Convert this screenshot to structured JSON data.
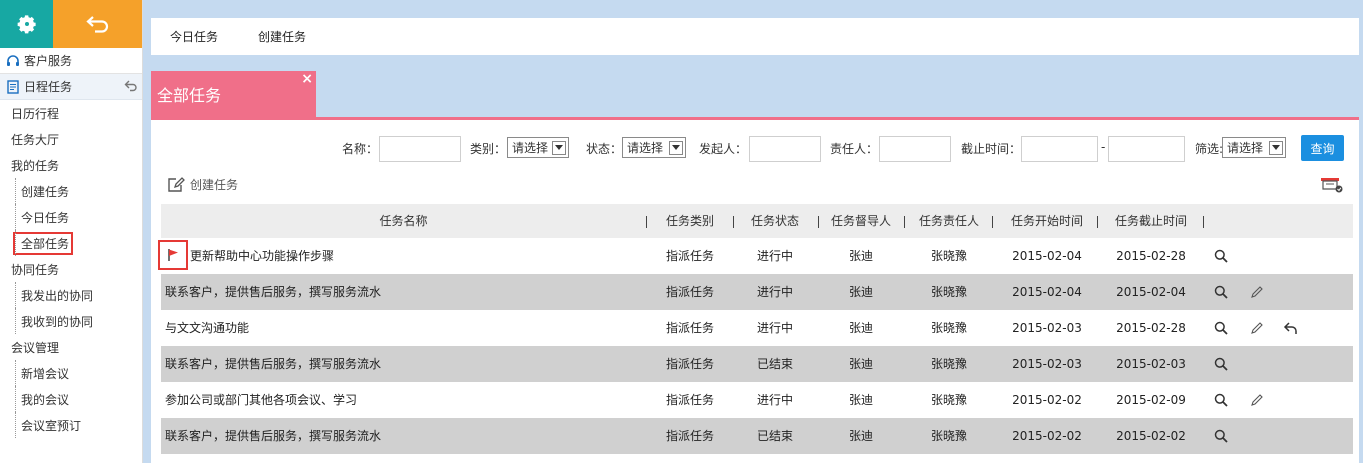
{
  "sidebar": {
    "customer_service": "客户服务",
    "schedule_section": "日程任务",
    "items": [
      {
        "label": "日历行程",
        "kind": "item"
      },
      {
        "label": "任务大厅",
        "kind": "item"
      },
      {
        "label": "我的任务",
        "kind": "item"
      },
      {
        "label": "创建任务",
        "kind": "sub"
      },
      {
        "label": "今日任务",
        "kind": "sub"
      },
      {
        "label": "全部任务",
        "kind": "sub",
        "active": true
      },
      {
        "label": "协同任务",
        "kind": "item"
      },
      {
        "label": "我发出的协同",
        "kind": "sub"
      },
      {
        "label": "我收到的协同",
        "kind": "sub"
      },
      {
        "label": "会议管理",
        "kind": "item"
      },
      {
        "label": "新增会议",
        "kind": "sub"
      },
      {
        "label": "我的会议",
        "kind": "sub"
      },
      {
        "label": "会议室预订",
        "kind": "sub"
      }
    ]
  },
  "topbar": {
    "tabs": [
      "今日任务",
      "创建任务"
    ]
  },
  "panel": {
    "title": "全部任务",
    "close": "×"
  },
  "filters": {
    "name_label": "名称：",
    "type_label": "类别：",
    "type_value": "请选择",
    "status_label": "状态：",
    "status_value": "请选择",
    "initiator_label": "发起人：",
    "owner_label": "责任人：",
    "deadline_label": "截止时间：",
    "range_sep": "-",
    "screen_label": "筛选:",
    "screen_value": "请选择",
    "query_button": "查询"
  },
  "create_link": "创建任务",
  "table": {
    "headers": [
      "任务名称",
      "任务类别",
      "任务状态",
      "任务督导人",
      "任务责任人",
      "任务开始时间",
      "任务截止时间"
    ],
    "rows": [
      {
        "name": "更新帮助中心功能操作步骤",
        "type": "指派任务",
        "status": "进行中",
        "supervisor": "张迪",
        "owner": "张晓豫",
        "start": "2015-02-04",
        "end": "2015-02-28",
        "actions": [
          "view"
        ],
        "flag": true
      },
      {
        "name": "联系客户，提供售后服务，撰写服务流水",
        "type": "指派任务",
        "status": "进行中",
        "supervisor": "张迪",
        "owner": "张晓豫",
        "start": "2015-02-04",
        "end": "2015-02-04",
        "actions": [
          "view",
          "edit"
        ]
      },
      {
        "name": "与文文沟通功能",
        "type": "指派任务",
        "status": "进行中",
        "supervisor": "张迪",
        "owner": "张晓豫",
        "start": "2015-02-03",
        "end": "2015-02-28",
        "actions": [
          "view",
          "edit",
          "reply"
        ]
      },
      {
        "name": "联系客户，提供售后服务，撰写服务流水",
        "type": "指派任务",
        "status": "已结束",
        "supervisor": "张迪",
        "owner": "张晓豫",
        "start": "2015-02-03",
        "end": "2015-02-03",
        "actions": [
          "view"
        ]
      },
      {
        "name": "参加公司或部门其他各项会议、学习",
        "type": "指派任务",
        "status": "进行中",
        "supervisor": "张迪",
        "owner": "张晓豫",
        "start": "2015-02-02",
        "end": "2015-02-09",
        "actions": [
          "view",
          "edit"
        ]
      },
      {
        "name": "联系客户，提供售后服务，撰写服务流水",
        "type": "指派任务",
        "status": "已结束",
        "supervisor": "张迪",
        "owner": "张晓豫",
        "start": "2015-02-02",
        "end": "2015-02-02",
        "actions": [
          "view"
        ]
      }
    ]
  },
  "colors": {
    "gear_bg": "#17a8a3",
    "back_bg": "#f5a12a",
    "panel_accent": "#f06f89",
    "query_button": "#1b8fe0",
    "highlight_box": "#e53935"
  }
}
